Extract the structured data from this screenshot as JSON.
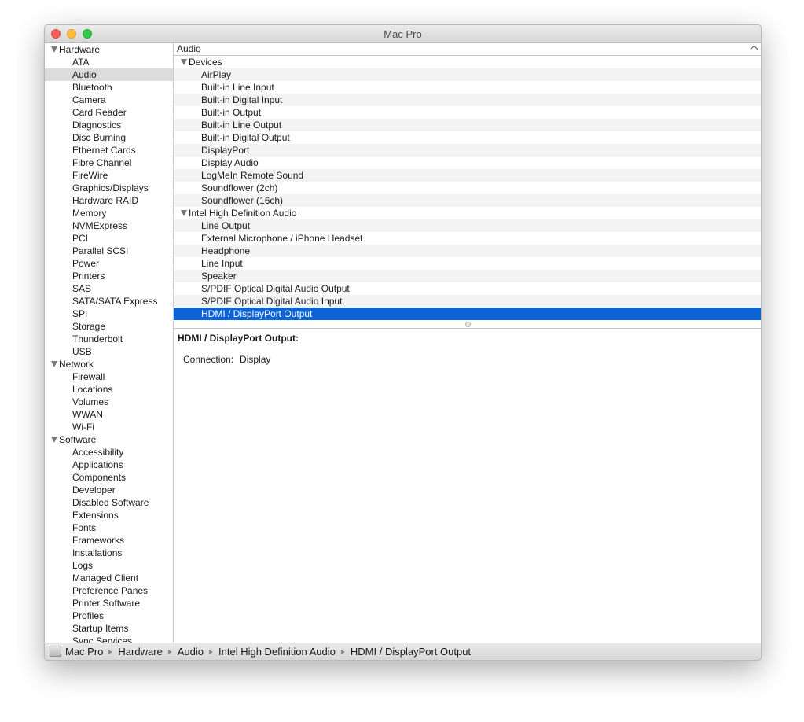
{
  "window": {
    "title": "Mac Pro"
  },
  "sidebar": {
    "groups": [
      {
        "label": "Hardware",
        "items": [
          "ATA",
          "Audio",
          "Bluetooth",
          "Camera",
          "Card Reader",
          "Diagnostics",
          "Disc Burning",
          "Ethernet Cards",
          "Fibre Channel",
          "FireWire",
          "Graphics/Displays",
          "Hardware RAID",
          "Memory",
          "NVMExpress",
          "PCI",
          "Parallel SCSI",
          "Power",
          "Printers",
          "SAS",
          "SATA/SATA Express",
          "SPI",
          "Storage",
          "Thunderbolt",
          "USB"
        ]
      },
      {
        "label": "Network",
        "items": [
          "Firewall",
          "Locations",
          "Volumes",
          "WWAN",
          "Wi-Fi"
        ]
      },
      {
        "label": "Software",
        "items": [
          "Accessibility",
          "Applications",
          "Components",
          "Developer",
          "Disabled Software",
          "Extensions",
          "Fonts",
          "Frameworks",
          "Installations",
          "Logs",
          "Managed Client",
          "Preference Panes",
          "Printer Software",
          "Profiles",
          "Startup Items",
          "Sync Services"
        ]
      }
    ],
    "selected": "Audio"
  },
  "table": {
    "column_header": "Audio",
    "groups": [
      {
        "label": "Devices",
        "items": [
          "AirPlay",
          "Built-in Line Input",
          "Built-in Digital Input",
          "Built-in Output",
          "Built-in Line Output",
          "Built-in Digital Output",
          "DisplayPort",
          "Display Audio",
          "LogMeIn Remote Sound",
          "Soundflower (2ch)",
          "Soundflower (16ch)"
        ]
      },
      {
        "label": "Intel High Definition Audio",
        "items": [
          "Line Output",
          "External Microphone / iPhone Headset",
          "Headphone",
          "Line Input",
          "Speaker",
          "S/PDIF Optical Digital Audio Output",
          "S/PDIF Optical Digital Audio Input",
          "HDMI / DisplayPort Output"
        ]
      }
    ],
    "selected": "HDMI / DisplayPort Output"
  },
  "detail": {
    "title": "HDMI / DisplayPort Output:",
    "connection_label": "Connection:",
    "connection_value": "Display"
  },
  "pathbar": {
    "crumbs": [
      "Mac Pro",
      "Hardware",
      "Audio",
      "Intel High Definition Audio",
      "HDMI / DisplayPort Output"
    ]
  },
  "colors": {
    "selection": "#0b62d6",
    "sidebar_selection": "#dcdcdc"
  }
}
